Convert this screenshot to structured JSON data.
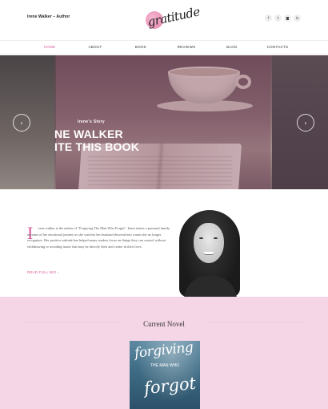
{
  "header": {
    "site_name": "Irene Walker – Author",
    "logo_text": "gratitude",
    "social": [
      {
        "icon": "facebook-icon",
        "glyph": "f"
      },
      {
        "icon": "twitter-icon",
        "glyph": "t"
      },
      {
        "icon": "instagram-icon",
        "glyph": "◙"
      },
      {
        "icon": "linkedin-icon",
        "glyph": "in"
      }
    ]
  },
  "nav": {
    "items": [
      {
        "label": "HOME",
        "active": true
      },
      {
        "label": "ABOUT",
        "active": false
      },
      {
        "label": "BOOK",
        "active": false
      },
      {
        "label": "REVIEWS",
        "active": false
      },
      {
        "label": "BLOG",
        "active": false
      },
      {
        "label": "CONTACTS",
        "active": false
      }
    ]
  },
  "hero": {
    "eyebrow": "Irene's Story",
    "line1": "NE WALKER",
    "line2": "ITE THIS BOOK",
    "prev_glyph": "‹",
    "next_glyph": "›"
  },
  "about": {
    "dropcap": "I",
    "bio": "rene walker is the author of \"Forgiving The Man Who Forgot\". Irene shares a personal family account of her emotional journey as she watches her husband descend into a man she no longer recognizes. Her positive attitude has helped many readers focus on things they can control without withdrawing or avoiding issues that may be directly their and center in their lives.",
    "read_more": "READ FULL BIO  ›"
  },
  "novel": {
    "heading": "Current Novel",
    "cover_line1": "forgiving",
    "cover_line2": "THE MAN WHO",
    "cover_line3": "forgot"
  },
  "colors": {
    "accent": "#d6599a",
    "novel_bg": "#f5d6e6"
  }
}
